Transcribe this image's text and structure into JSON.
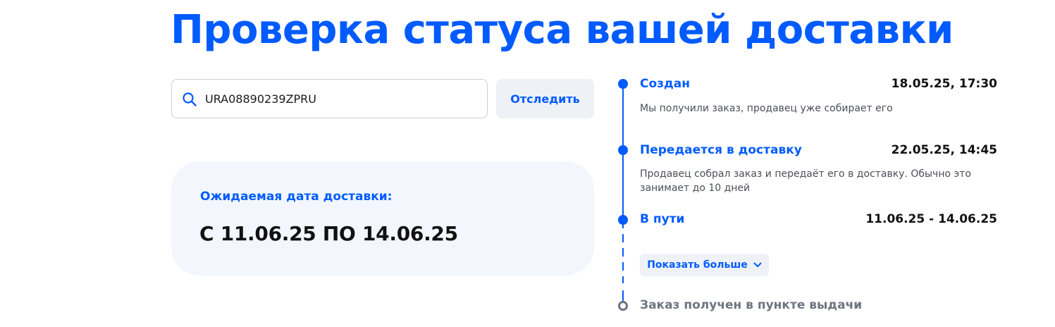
{
  "page": {
    "title": "Проверка статуса вашей доставки"
  },
  "search": {
    "value": "URA08890239ZPRU",
    "button_label": "Отследить",
    "icon": "search-icon"
  },
  "delivery": {
    "label": "Ожидаемая дата доставки:",
    "range": "С 11.06.25 ПО 14.06.25"
  },
  "timeline": {
    "steps": [
      {
        "title": "Создан",
        "date": "18.05.25, 17:30",
        "description": "Мы получили заказ, продавец уже собирает его"
      },
      {
        "title": "Передается в доставку",
        "date": "22.05.25, 14:45",
        "description": "Продавец собрал заказ и передаёт его в доставку. Обычно это занимает до 10 дней"
      },
      {
        "title": "В пути",
        "date": "11.06.25 - 14.06.25"
      }
    ],
    "show_more_label": "Показать больше",
    "final_step": "Заказ получен в пункте выдачи"
  },
  "colors": {
    "accent": "#005bff",
    "card_bg": "#f3f7fd",
    "button_bg": "#eef1f6",
    "muted": "#6f7580"
  }
}
